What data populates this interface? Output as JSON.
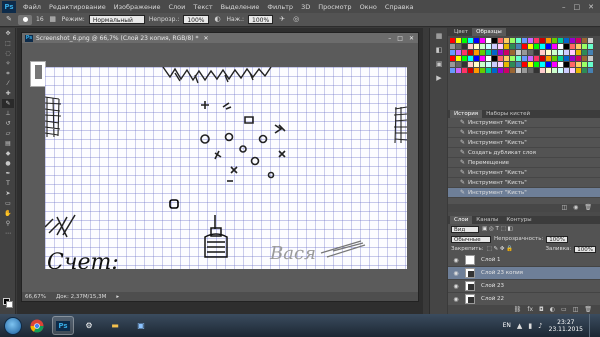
{
  "app": {
    "logo": "Ps",
    "menu": [
      "Файл",
      "Редактирование",
      "Изображение",
      "Слои",
      "Текст",
      "Выделение",
      "Фильтр",
      "3D",
      "Просмотр",
      "Окно",
      "Справка"
    ],
    "window_controls": [
      "–",
      "□",
      "✕"
    ]
  },
  "options": {
    "brush_size": "16",
    "mode_label": "Режим:",
    "mode_value": "Нормальный",
    "opacity_label": "Непрозр.:",
    "opacity_value": "100%",
    "flow_label": "Наж.:",
    "flow_value": "100%"
  },
  "document": {
    "title": "Screenshot_6.png @ 66,7% (Слой 23 копия, RGB/8) *",
    "close": "✕",
    "zoom": "66,67%",
    "doc_info": "Док: 2,37М/15,3М",
    "controls": [
      "–",
      "□",
      "✕"
    ]
  },
  "canvas": {
    "score_label": "Счет:",
    "signature": "Вася"
  },
  "swatches_panel": {
    "tabs": [
      "Цвет",
      "Образцы"
    ],
    "active_tab": 1,
    "colors": [
      "#ff0000",
      "#ffff00",
      "#00ff00",
      "#00ffff",
      "#0000ff",
      "#ff00ff",
      "#ffffff",
      "#000000",
      "#ff6666",
      "#ffcc66",
      "#99ff66",
      "#66ffcc",
      "#6699ff",
      "#cc66ff",
      "#ff3366",
      "#cc0000",
      "#ff9900",
      "#66cc00",
      "#00cc99",
      "#0066cc",
      "#9900cc",
      "#cc0066",
      "#996633",
      "#cccccc",
      "#999999",
      "#666666",
      "#333333",
      "#ffcccc",
      "#ffffcc",
      "#ccffcc",
      "#ccffff",
      "#ccccff",
      "#ffccff",
      "#e6b800",
      "#2e8b57",
      "#4682b4"
    ]
  },
  "history": {
    "tabs": [
      "История",
      "Наборы кистей"
    ],
    "active_tab": 0,
    "rows": [
      {
        "label": "Инструмент \"Кисть\"",
        "selected": false
      },
      {
        "label": "Инструмент \"Кисть\"",
        "selected": false
      },
      {
        "label": "Инструмент \"Кисть\"",
        "selected": false
      },
      {
        "label": "Создать дубликат слоя",
        "selected": false
      },
      {
        "label": "Перемещение",
        "selected": false
      },
      {
        "label": "Инструмент \"Кисть\"",
        "selected": false
      },
      {
        "label": "Инструмент \"Кисть\"",
        "selected": false
      },
      {
        "label": "Инструмент \"Кисть\"",
        "selected": true
      }
    ]
  },
  "layers": {
    "tabs": [
      "Слои",
      "Каналы",
      "Контуры"
    ],
    "active_tab": 0,
    "filter_label": "Вид",
    "blend_mode": "Обычные",
    "opacity_label": "Непрозрачность:",
    "opacity_value": "100%",
    "lock_label": "Закрепить:",
    "fill_label": "Заливка:",
    "fill_value": "100%",
    "items": [
      {
        "name": "Слой 1",
        "selected": false,
        "thumb": "light"
      },
      {
        "name": "Слой 23 копия",
        "selected": true,
        "thumb": "dark"
      },
      {
        "name": "Слой 23",
        "selected": false,
        "thumb": "dark"
      },
      {
        "name": "Слой 22",
        "selected": false,
        "thumb": "dark"
      }
    ]
  },
  "taskbar": {
    "lang": "EN",
    "time": "23:27",
    "date": "23.11.2015"
  }
}
